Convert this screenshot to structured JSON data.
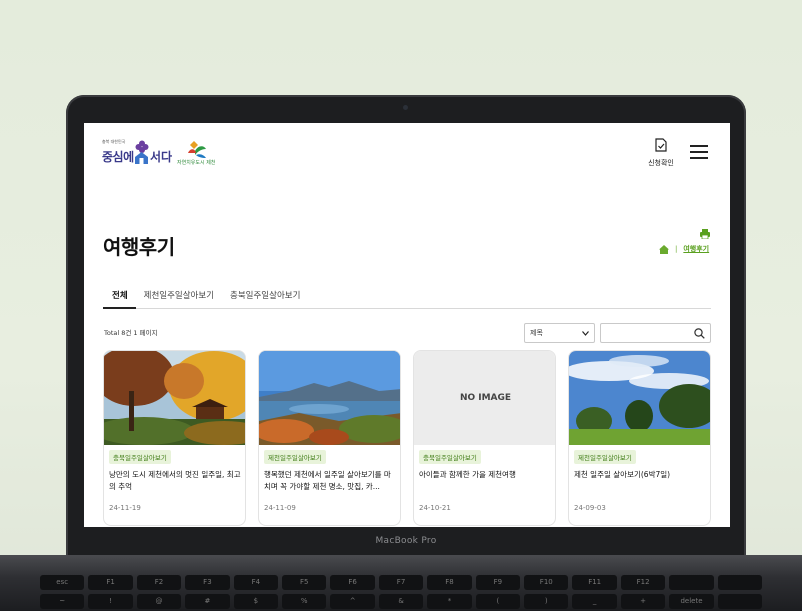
{
  "device": {
    "brand_label": "MacBook Pro"
  },
  "header": {
    "logo_small_text": "충북 대한민국",
    "logo_text": "중심에",
    "logo_text2": "서다",
    "logo2_text": "자연치유도시 제천",
    "apply_check_label": "신청확인",
    "menu_icon": "hamburger-icon"
  },
  "page": {
    "title": "여행후기",
    "breadcrumb_current": "여행후기",
    "breadcrumb_sep": "|"
  },
  "tabs": [
    {
      "label": "전체",
      "active": true
    },
    {
      "label": "제천일주일살아보기",
      "active": false
    },
    {
      "label": "충북일주일살아보기",
      "active": false
    }
  ],
  "list": {
    "total_text": "Total 8건 1 페이지",
    "select_value": "제목",
    "search_placeholder": ""
  },
  "cards": [
    {
      "tag": "충북일주일살아보기",
      "title": "낭만의 도시 제천에서의 멋진 일주일, 최고의 추억",
      "date": "24-11-19",
      "image": "autumn-pavilion"
    },
    {
      "tag": "제천일주일살아보기",
      "title": "행복했던 제천에서 일주일 살아보기를 마치며 꼭 가야할 제천 명소, 맛집, 카...",
      "date": "24-11-09",
      "image": "lake-view"
    },
    {
      "tag": "충북일주일살아보기",
      "title": "아이들과 함께한 가을 제천여행",
      "date": "24-10-21",
      "image": "none",
      "no_image_text": "NO IMAGE"
    },
    {
      "tag": "제천일주일살아보기",
      "title": "제천 일주일 살아보기(6박7일)",
      "date": "24-09-03",
      "image": "park-sky"
    }
  ],
  "keyboard": {
    "row1": [
      "esc",
      "F1",
      "F2",
      "F3",
      "F4",
      "F5",
      "F6",
      "F7",
      "F8",
      "F9",
      "F10",
      "F11",
      "F12",
      "",
      ""
    ],
    "row2": [
      "~",
      "!",
      "@",
      "#",
      "$",
      "%",
      "^",
      "&",
      "*",
      "(",
      ")",
      "_",
      "+",
      "delete",
      ""
    ]
  },
  "colors": {
    "accent_green": "#5aa01f",
    "tag_bg": "#e8f3da",
    "logo_navy": "#3a3a8a"
  }
}
